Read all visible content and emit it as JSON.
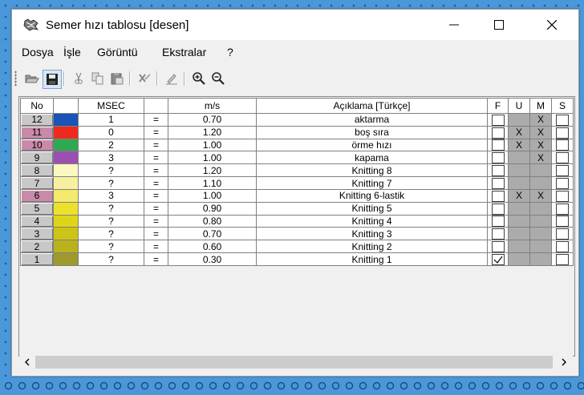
{
  "window": {
    "title": "Semer hızı tablosu [desen]"
  },
  "menu": [
    "Dosya",
    "İşle",
    "Görüntü",
    "Ekstralar",
    "?"
  ],
  "columns": {
    "no": "No",
    "msec": "MSEC",
    "ms": "m/s",
    "desc": "Açıklama [Türkçe]",
    "f": "F",
    "u": "U",
    "m": "M",
    "s": "S"
  },
  "rows": [
    {
      "no": "12",
      "pink": false,
      "color": "#1a54b8",
      "msec": "1",
      "eq": "=",
      "ms": "0.70",
      "desc": "aktarma",
      "f": false,
      "u": "",
      "m": "X",
      "s": false
    },
    {
      "no": "11",
      "pink": true,
      "color": "#ee2a1e",
      "msec": "0",
      "eq": "=",
      "ms": "1.20",
      "desc": "boş sıra",
      "f": false,
      "u": "X",
      "m": "X",
      "s": false
    },
    {
      "no": "10",
      "pink": true,
      "color": "#2fa84f",
      "msec": "2",
      "eq": "=",
      "ms": "1.00",
      "desc": "örme hızı",
      "f": false,
      "u": "X",
      "m": "X",
      "s": false
    },
    {
      "no": "9",
      "pink": false,
      "color": "#9b50b0",
      "msec": "3",
      "eq": "=",
      "ms": "1.00",
      "desc": "kapama",
      "f": false,
      "u": "",
      "m": "X",
      "s": false
    },
    {
      "no": "8",
      "pink": false,
      "color": "#fbf7c0",
      "msec": "?",
      "eq": "=",
      "ms": "1.20",
      "desc": "Knitting 8",
      "f": false,
      "u": "",
      "m": "",
      "s": false
    },
    {
      "no": "7",
      "pink": false,
      "color": "#f8f0a0",
      "msec": "?",
      "eq": "=",
      "ms": "1.10",
      "desc": "Knitting 7",
      "f": false,
      "u": "",
      "m": "",
      "s": false
    },
    {
      "no": "6",
      "pink": true,
      "color": "#f4ea6e",
      "msec": "3",
      "eq": "=",
      "ms": "1.00",
      "desc": "Knitting 6-lastik",
      "f": false,
      "u": "X",
      "m": "X",
      "s": false
    },
    {
      "no": "5",
      "pink": false,
      "color": "#ece22c",
      "msec": "?",
      "eq": "=",
      "ms": "0.90",
      "desc": "Knitting 5",
      "f": false,
      "u": "",
      "m": "",
      "s": false
    },
    {
      "no": "4",
      "pink": false,
      "color": "#e0d418",
      "msec": "?",
      "eq": "=",
      "ms": "0.80",
      "desc": "Knitting 4",
      "f": false,
      "u": "",
      "m": "",
      "s": false
    },
    {
      "no": "3",
      "pink": false,
      "color": "#cec416",
      "msec": "?",
      "eq": "=",
      "ms": "0.70",
      "desc": "Knitting 3",
      "f": false,
      "u": "",
      "m": "",
      "s": false
    },
    {
      "no": "2",
      "pink": false,
      "color": "#b9b21e",
      "msec": "?",
      "eq": "=",
      "ms": "0.60",
      "desc": "Knitting 2",
      "f": false,
      "u": "",
      "m": "",
      "s": false
    },
    {
      "no": "1",
      "pink": false,
      "color": "#9e9a2c",
      "msec": "?",
      "eq": "=",
      "ms": "0.30",
      "desc": "Knitting 1",
      "f": true,
      "u": "",
      "m": "",
      "s": false
    }
  ],
  "toolbar_icons": [
    "open-folder-icon",
    "save-icon",
    "cut-icon",
    "copy-icon",
    "paste-icon",
    "delete-icon",
    "edit-icon",
    "zoom-in-icon",
    "zoom-out-icon"
  ],
  "colors": {
    "accent_pink": "#c98aaa",
    "background": "#4a98da"
  }
}
